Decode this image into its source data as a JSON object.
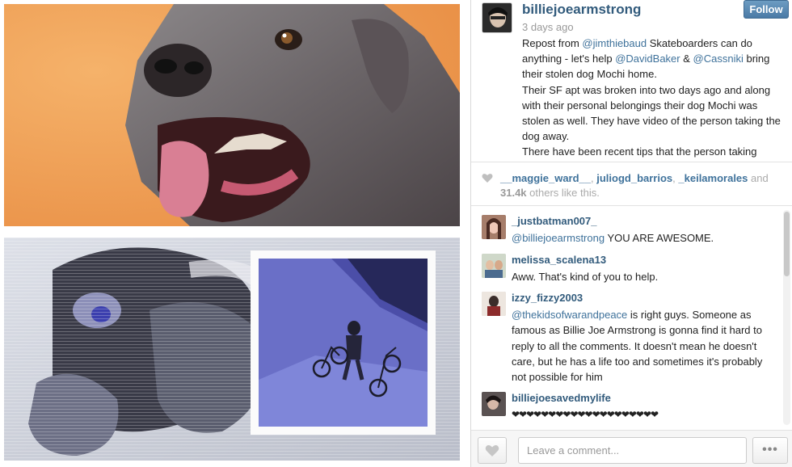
{
  "post": {
    "username": "billiejoearmstrong",
    "time_ago": "3 days ago",
    "follow_label": "Follow",
    "caption": {
      "line1_prefix": "Repost from ",
      "mention_jim": "@jimthiebaud",
      "line1_mid": " Skateboarders can do anything - let's help ",
      "mention_david": "@DavidBaker",
      "amp": " & ",
      "mention_cass": "@Cassniki",
      "line1_suffix": " bring their stolen dog Mochi home.",
      "para2": "Their SF apt was broken into two days ago and along with their personal belongings their dog Mochi was stolen as well. They have video of the person taking the dog away.",
      "para3": "There have been recent tips that the person taking"
    }
  },
  "likes": {
    "liker1": "__maggie_ward__",
    "sep1": ", ",
    "liker2": "juliogd_barrios",
    "sep2": ", ",
    "liker3": "_keilamorales",
    "and": " and",
    "count": "31.4k",
    "others": " others like this."
  },
  "comments": [
    {
      "user": "_justbatman007_",
      "mention": "@billiejoearmstrong",
      "text": " YOU ARE AWESOME."
    },
    {
      "user": "melissa_scalena13",
      "text": "Aww. That's kind of you to help."
    },
    {
      "user": "izzy_fizzy2003",
      "mention": "@thekidsofwarandpeace",
      "text": " is right guys. Someone as famous as Billie Joe Armstrong is gonna find it hard to reply to all the comments. It doesn't mean he doesn't care, but he has a life too and sometimes it's probably not possible for him"
    },
    {
      "user": "billiejoesavedmylife",
      "text": "❤❤❤❤❤❤❤❤❤❤❤❤❤❤❤❤❤❤❤❤"
    }
  ],
  "footer": {
    "comment_placeholder": "Leave a comment...",
    "more_label": "•••"
  },
  "colors": {
    "username": "#325b7c",
    "mention": "#3f729b",
    "follow_button": "#5886b1",
    "orange_background": "#ef9f57"
  }
}
